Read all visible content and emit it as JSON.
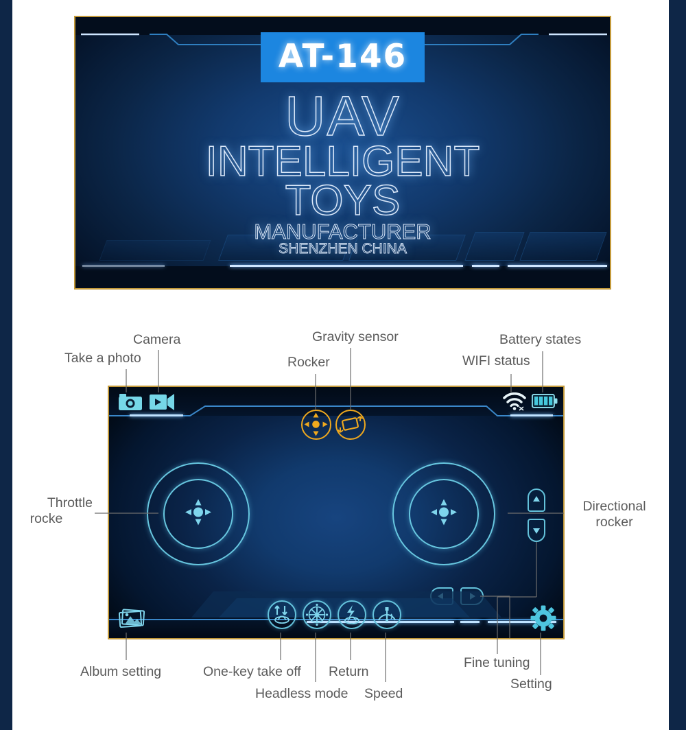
{
  "splash": {
    "model_badge": "AT-146",
    "line1": "UAV",
    "line2": "INTELLIGENT",
    "line3": "TOYS",
    "line4": "MANUFACTURER",
    "line5": "SHENZHEN CHINA",
    "badge_color": "#1c86e0",
    "border_color": "#c49a3a"
  },
  "controller": {
    "accent_cyan": "#76d7e8",
    "accent_orange": "#f0a91e",
    "frame_color": "#c49a3a",
    "top_icons": [
      {
        "name": "take-photo-icon",
        "label": "Take a photo"
      },
      {
        "name": "camera-video-icon",
        "label": "Camera"
      }
    ],
    "mode_buttons": [
      {
        "name": "rocker-mode-button",
        "label": "Rocker"
      },
      {
        "name": "gravity-sensor-button",
        "label": "Gravity sensor"
      }
    ],
    "status_icons": [
      {
        "name": "wifi-status-icon",
        "label": "WIFI status"
      },
      {
        "name": "battery-status-icon",
        "label": "Battery states"
      }
    ],
    "rockers": [
      {
        "name": "throttle-rocker",
        "label": "Throttle\nrocke"
      },
      {
        "name": "directional-rocker",
        "label": "Directional\nrocker"
      }
    ],
    "bottom_icons": [
      {
        "name": "one-key-takeoff-button",
        "label": "One-key take off"
      },
      {
        "name": "headless-mode-button",
        "label": "Headless mode"
      },
      {
        "name": "return-button",
        "label": "Return"
      },
      {
        "name": "speed-button",
        "label": "Speed"
      }
    ],
    "album_button": {
      "name": "album-setting-button",
      "label": "Album setting"
    },
    "setting_button": {
      "name": "setting-button",
      "label": "Setting"
    },
    "fine_tuning": {
      "name": "fine-tuning-buttons",
      "label": "Fine tuning"
    }
  },
  "labels": {
    "take_a_photo": "Take a photo",
    "camera": "Camera",
    "rocker": "Rocker",
    "gravity_sensor": "Gravity sensor",
    "wifi_status": "WIFI status",
    "battery_states": "Battery states",
    "throttle_rocker_l1": "Throttle",
    "throttle_rocker_l2": "rocke",
    "directional_rocker_l1": "Directional",
    "directional_rocker_l2": "rocker",
    "album_setting": "Album setting",
    "one_key_take_off": "One-key take off",
    "headless_mode": "Headless mode",
    "return": "Return",
    "speed": "Speed",
    "fine_tuning": "Fine tuning",
    "setting": "Setting"
  }
}
